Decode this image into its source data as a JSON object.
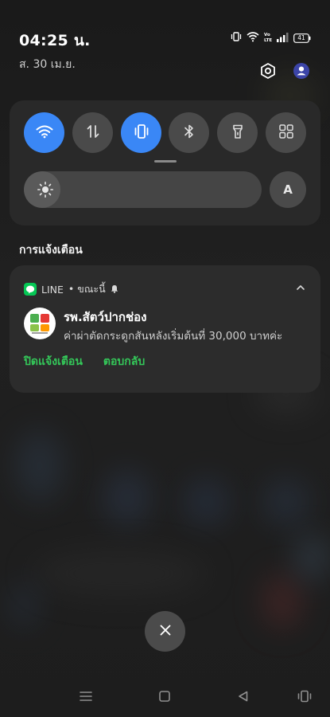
{
  "status_bar": {
    "time": "04:25 น.",
    "date": "ส. 30 เม.ย.",
    "battery": "41",
    "icons": [
      "vibrate-icon",
      "wifi-icon",
      "volte-icon",
      "signal-icon",
      "battery-icon"
    ]
  },
  "header_actions": [
    "settings-icon",
    "user-account-icon"
  ],
  "quick_settings": {
    "tiles": [
      {
        "name": "wifi",
        "icon": "wifi-icon",
        "on": true
      },
      {
        "name": "mobile-data",
        "icon": "data-transfer-icon",
        "on": false
      },
      {
        "name": "vibrate",
        "icon": "vibrate-icon",
        "on": true
      },
      {
        "name": "bluetooth",
        "icon": "bluetooth-icon",
        "on": false
      },
      {
        "name": "flashlight",
        "icon": "flashlight-icon",
        "on": false
      },
      {
        "name": "more",
        "icon": "grid-icon",
        "on": false
      }
    ],
    "brightness_level": 0.05,
    "auto_brightness_label": "A"
  },
  "notifications": {
    "section_title": "การแจ้งเตือน",
    "items": [
      {
        "app": "LINE",
        "time": "• ขณะนี้",
        "sender": "รพ.สัตว์ปากช่อง",
        "message": "ค่าผ่าตัดกระดูกสันหลังเริ่มต้นที่ 30,000 บาทค่ะ",
        "actions": [
          "ปิดแจ้งเตือน",
          "ตอบกลับ"
        ]
      }
    ]
  },
  "colors": {
    "accent": "#3a87f6",
    "line_green": "#06c755",
    "action_green": "#34c759"
  }
}
